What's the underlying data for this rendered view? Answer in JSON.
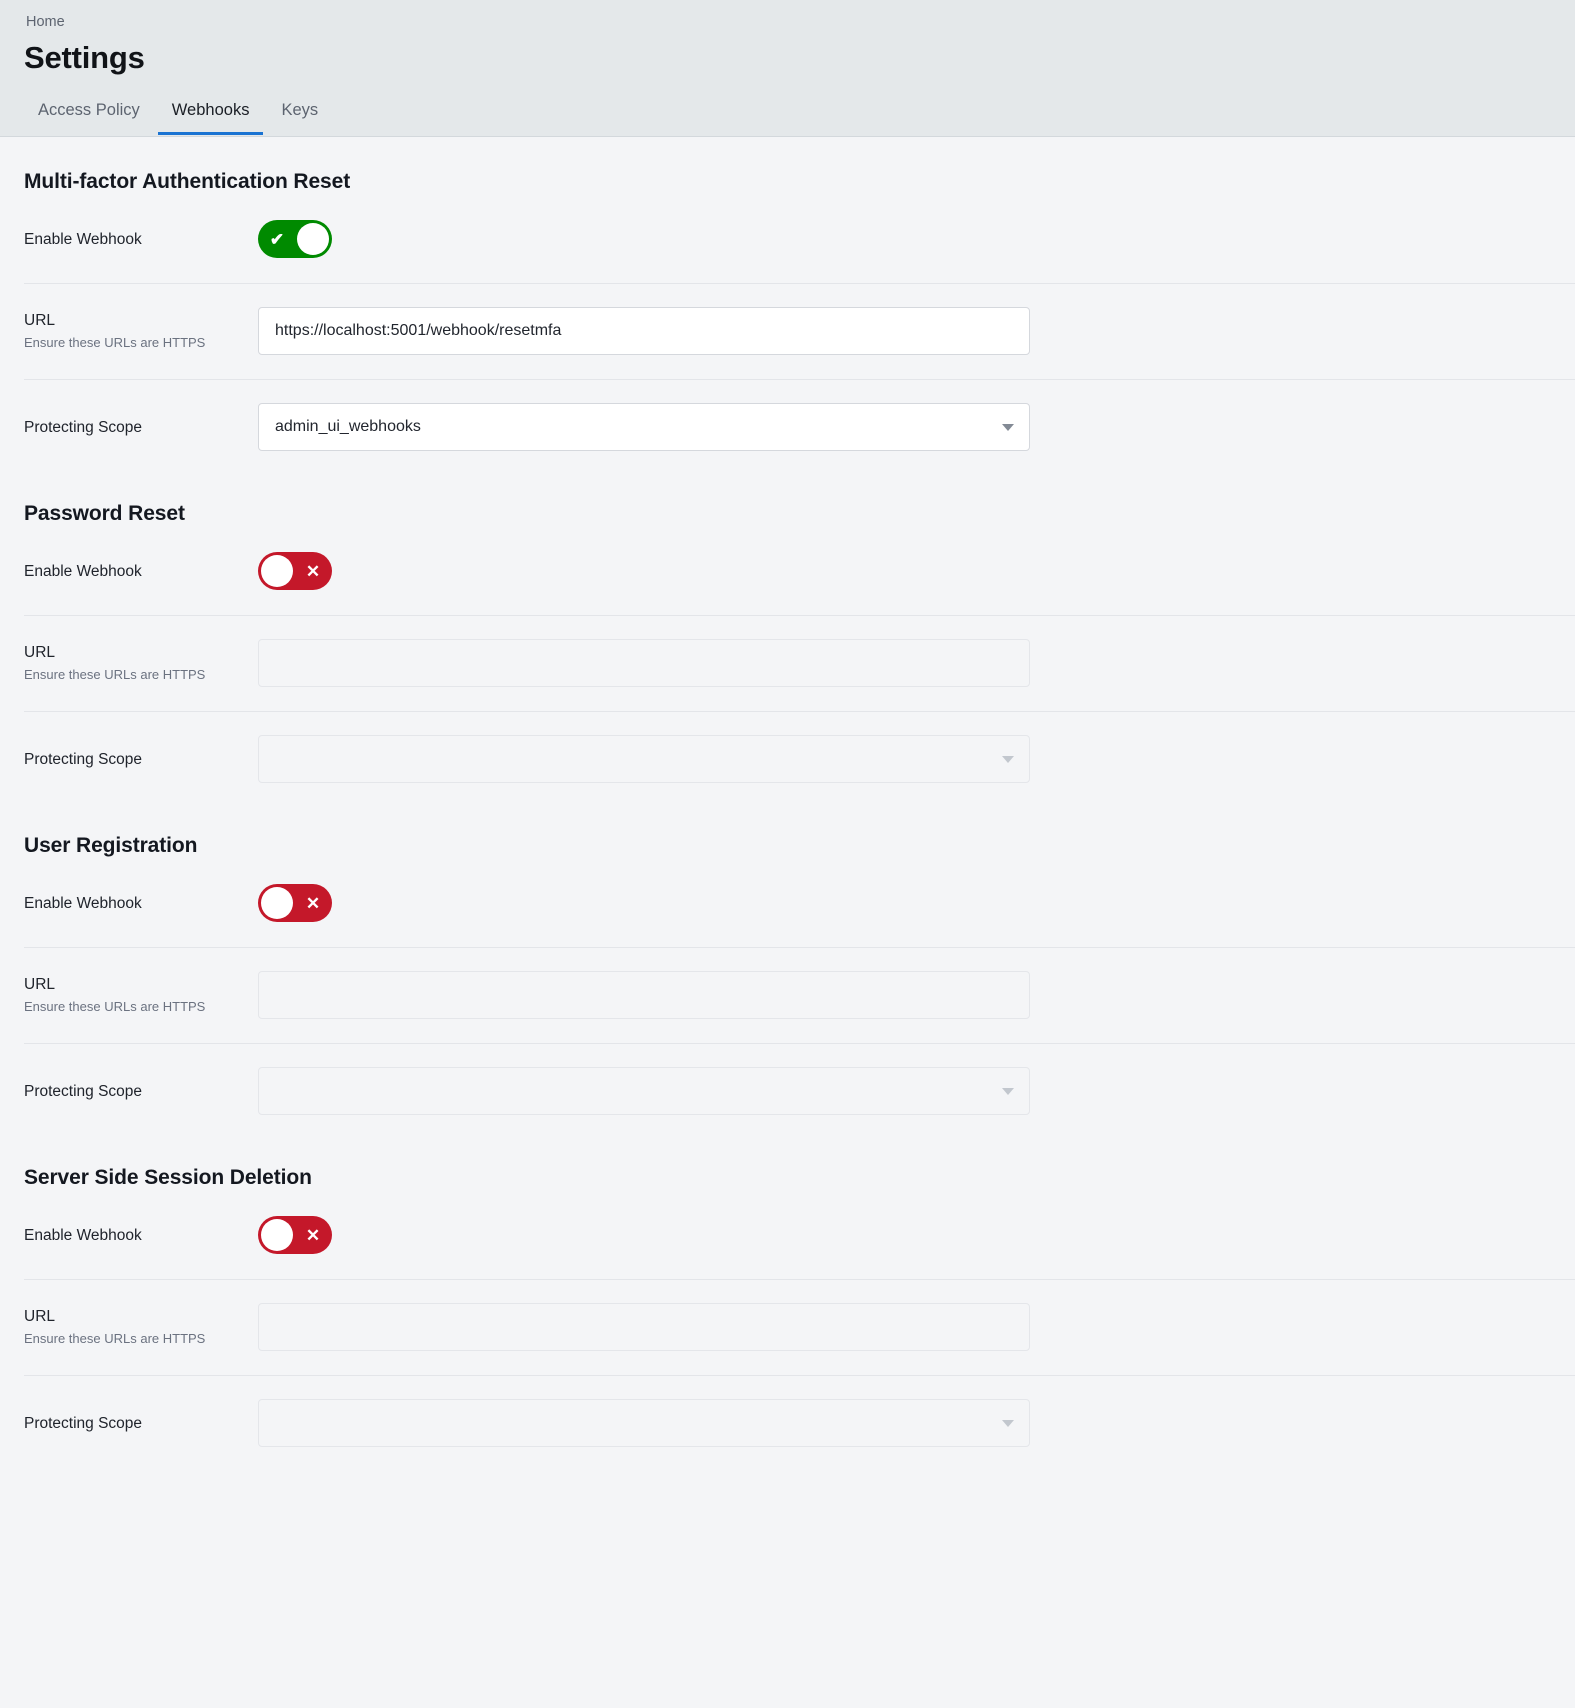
{
  "header": {
    "breadcrumb": "Home",
    "title": "Settings",
    "tabs": [
      {
        "label": "Access Policy",
        "active": false
      },
      {
        "label": "Webhooks",
        "active": true
      },
      {
        "label": "Keys",
        "active": false
      }
    ],
    "active_tab_color": "#1a73d2"
  },
  "labels": {
    "enable_webhook": "Enable Webhook",
    "url": "URL",
    "url_hint": "Ensure these URLs are HTTPS",
    "protecting_scope": "Protecting Scope"
  },
  "toggle": {
    "on_icon": "check-icon",
    "off_icon": "close-icon",
    "on_glyph": "✔",
    "off_glyph": "✕",
    "on_color": "#008a00",
    "off_color": "#c4182a"
  },
  "sections": [
    {
      "title": "Multi-factor Authentication Reset",
      "enabled": true,
      "url_value": "https://localhost:5001/webhook/resetmfa",
      "url_placeholder": "",
      "scope_value": "admin_ui_webhooks",
      "scope_placeholder": ""
    },
    {
      "title": "Password Reset",
      "enabled": false,
      "url_value": "",
      "url_placeholder": "",
      "scope_value": "",
      "scope_placeholder": ""
    },
    {
      "title": "User Registration",
      "enabled": false,
      "url_value": "",
      "url_placeholder": "",
      "scope_value": "",
      "scope_placeholder": ""
    },
    {
      "title": "Server Side Session Deletion",
      "enabled": false,
      "url_value": "",
      "url_placeholder": "",
      "scope_value": "",
      "scope_placeholder": ""
    }
  ]
}
